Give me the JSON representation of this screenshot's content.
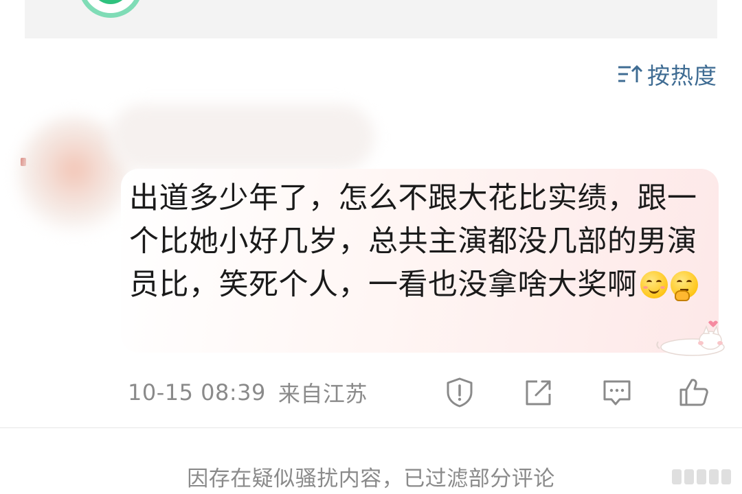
{
  "sort": {
    "label": "按热度",
    "icon": "sort-icon"
  },
  "comment": {
    "text": "出道多少年了，怎么不跟大花比实绩，跟一个比她小好几岁，总共主演都没几部的男演员比，笑死个人，一看也没拿啥大奖啊",
    "emojis": [
      "smiling-blush-emoji",
      "thinking-emoji"
    ],
    "time": "10-15 08:39",
    "location": "来自江苏"
  },
  "actions": {
    "report_icon": "shield-alert-icon",
    "share_icon": "share-icon",
    "reply_icon": "comment-icon",
    "like_icon": "thumbs-up-icon"
  },
  "notice": {
    "text": "因存在疑似骚扰内容，已过滤部分评论"
  },
  "colors": {
    "sort_text": "#3f6c93",
    "meta_text": "#8a8a8a",
    "bubble_tint": "#fde8e8"
  }
}
